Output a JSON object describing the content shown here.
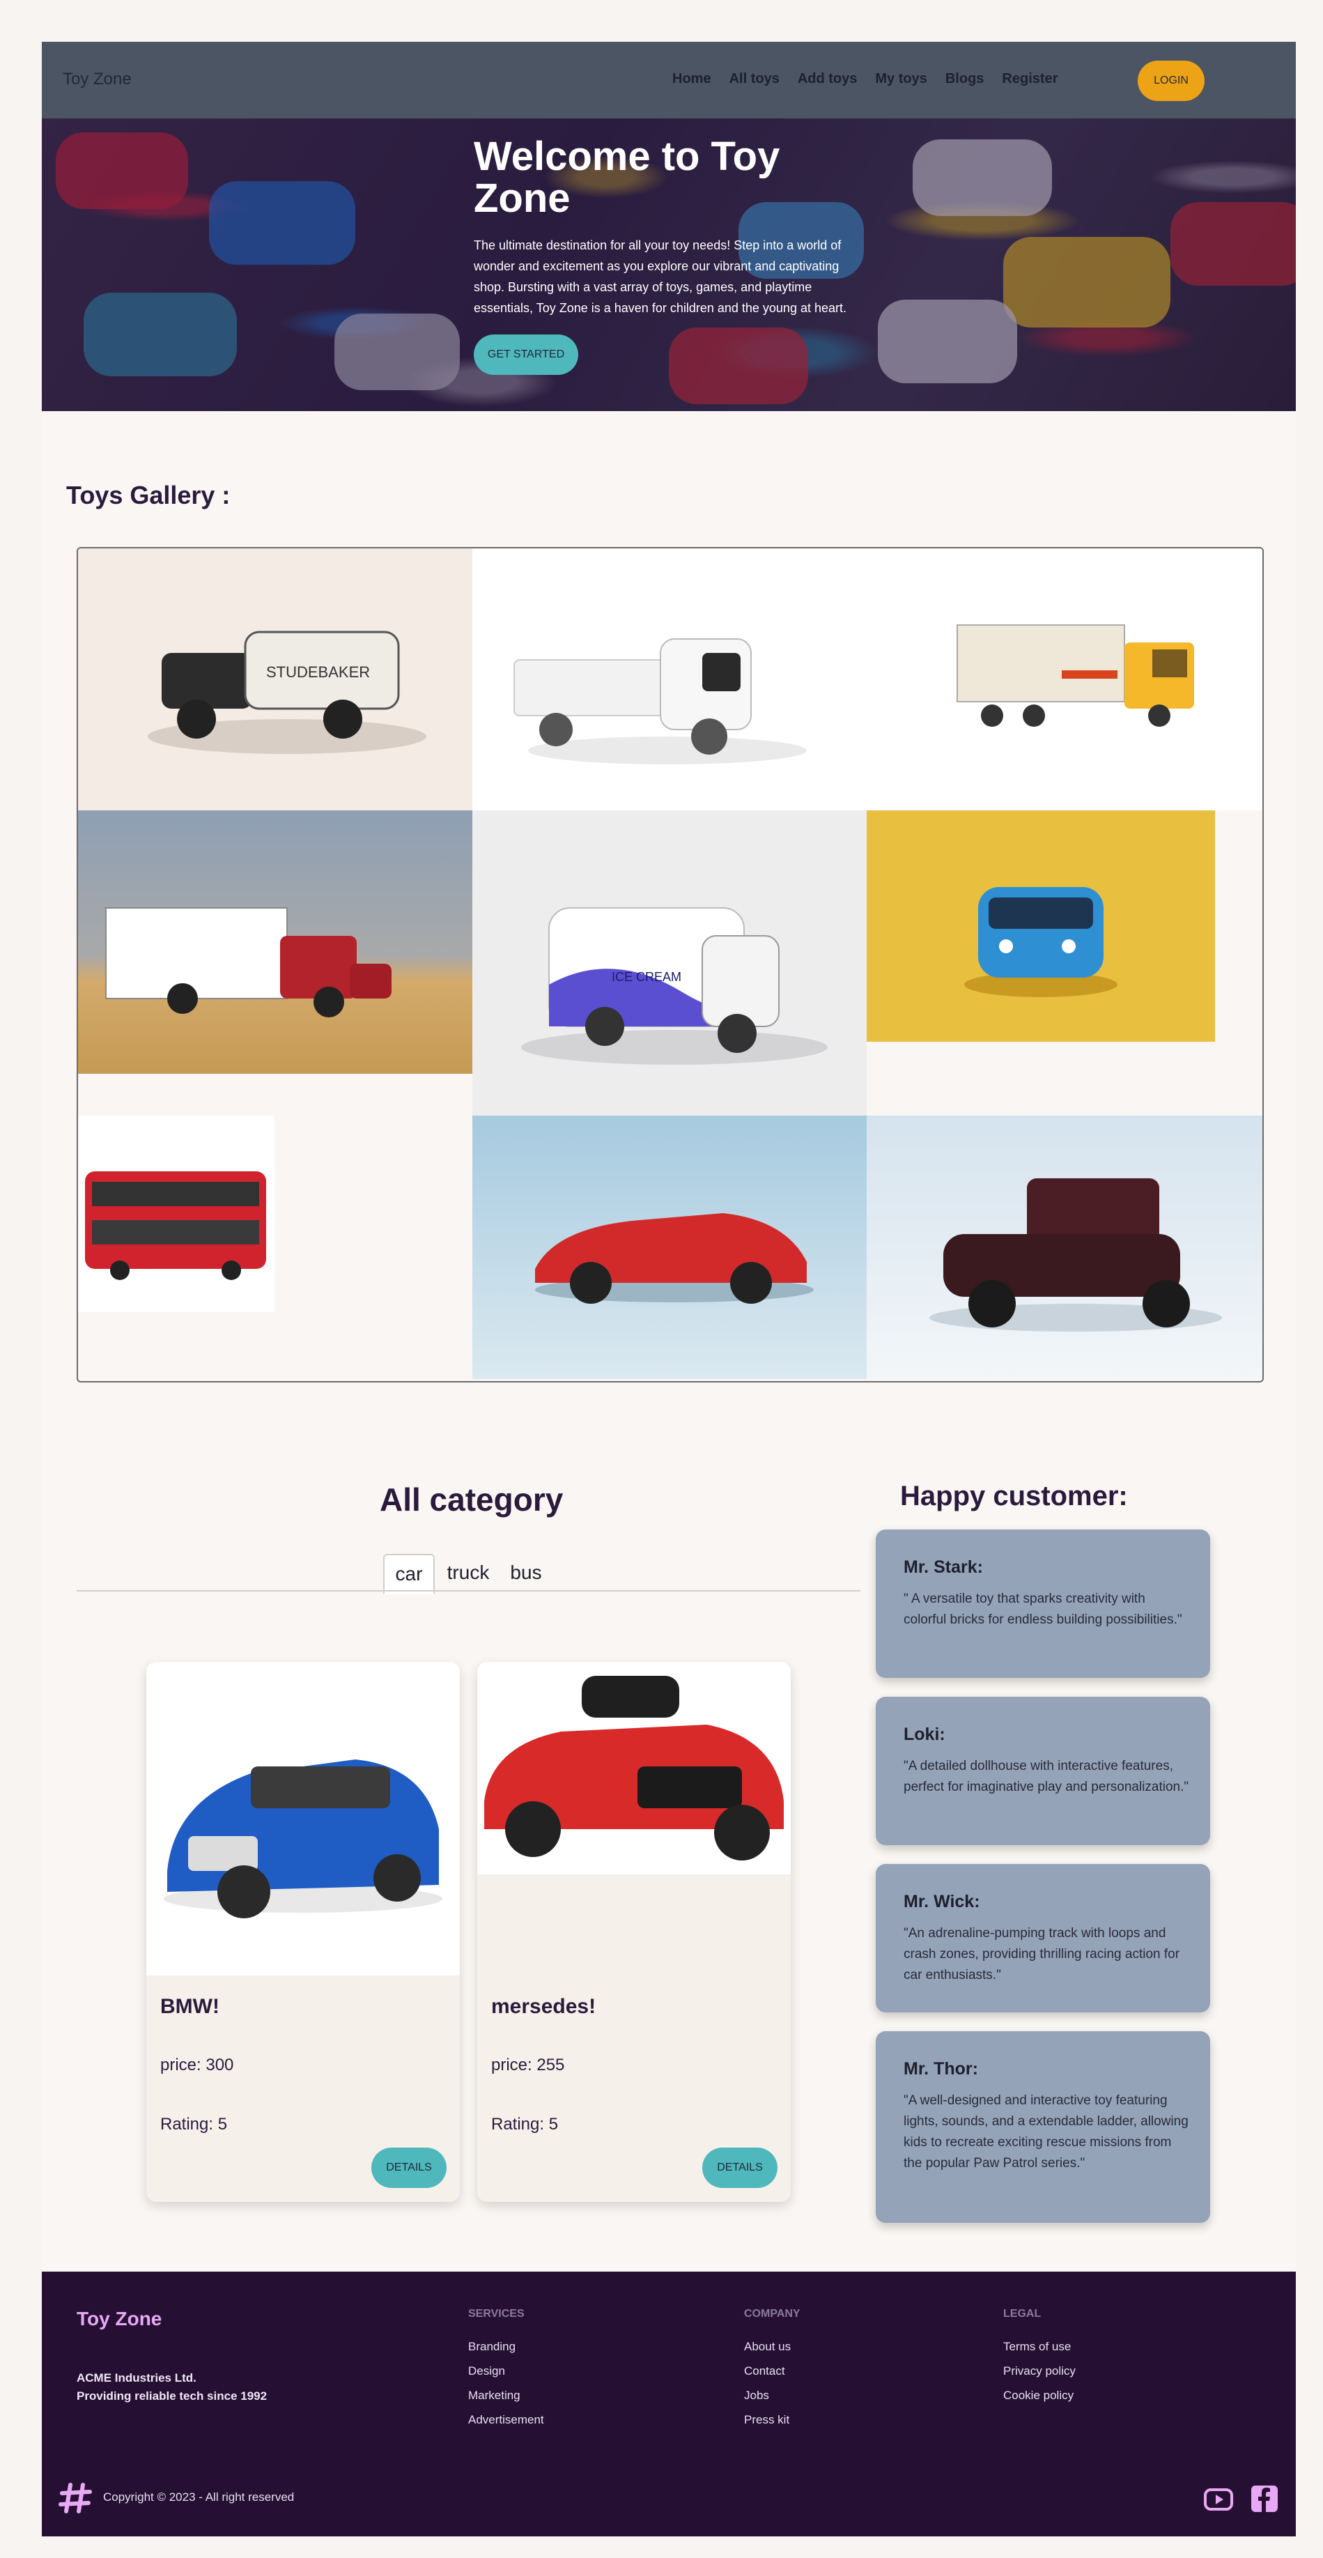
{
  "navbar": {
    "brand": "Toy Zone",
    "links": [
      "Home",
      "All toys",
      "Add toys",
      "My toys",
      "Blogs",
      "Register"
    ],
    "login_label": "LOGIN"
  },
  "hero": {
    "title": "Welcome to Toy Zone",
    "text": "The ultimate destination for all your toy needs! Step into a world of wonder and excitement as you explore our vibrant and captivating shop. Bursting with a vast array of toys, games, and playtime essentials, Toy Zone is a haven for children and the young at heart.",
    "button_label": "GET STARTED"
  },
  "gallery": {
    "title": "Toys Gallery :"
  },
  "category": {
    "title": "All category",
    "tabs": [
      "car",
      "truck",
      "bus"
    ],
    "cards": [
      {
        "name": "BMW!",
        "price": "price: 300",
        "rating": "Rating: 5",
        "button": "DETAILS"
      },
      {
        "name": "mersedes!",
        "price": "price: 255",
        "rating": "Rating: 5",
        "button": "DETAILS"
      }
    ]
  },
  "customers": {
    "title": "Happy customer:",
    "items": [
      {
        "name": "Mr. Stark:",
        "text": "\" A versatile toy that sparks creativity with colorful bricks for endless building possibilities.\""
      },
      {
        "name": "Loki:",
        "text": "\"A detailed dollhouse with interactive features, perfect for imaginative play and personalization.\""
      },
      {
        "name": "Mr. Wick:",
        "text": "\"An adrenaline-pumping track with loops and crash zones, providing thrilling racing action for car enthusiasts.\""
      },
      {
        "name": "Mr. Thor:",
        "text": "\"A well-designed and interactive toy featuring lights, sounds, and a extendable ladder, allowing kids to recreate exciting rescue missions from the popular Paw Patrol series.\""
      }
    ]
  },
  "footer": {
    "brand": "Toy Zone",
    "company_line1": "ACME Industries Ltd.",
    "company_line2": "Providing reliable tech since 1992",
    "services": {
      "heading": "SERVICES",
      "links": [
        "Branding",
        "Design",
        "Marketing",
        "Advertisement"
      ]
    },
    "company": {
      "heading": "COMPANY",
      "links": [
        "About us",
        "Contact",
        "Jobs",
        "Press kit"
      ]
    },
    "legal": {
      "heading": "LEGAL",
      "links": [
        "Terms of use",
        "Privacy policy",
        "Cookie policy"
      ]
    },
    "copyright": "Copyright © 2023 - All right reserved"
  },
  "colors": {
    "navbar": "#4b5563",
    "accent_orange": "#eda316",
    "accent_teal": "#4fb8bd",
    "testimonial_bg": "#94a3b8",
    "footer_bg": "#251034",
    "footer_brand": "#e9a8f4"
  },
  "icons": [
    "youtube-icon",
    "facebook-icon",
    "logo-hash-icon"
  ]
}
